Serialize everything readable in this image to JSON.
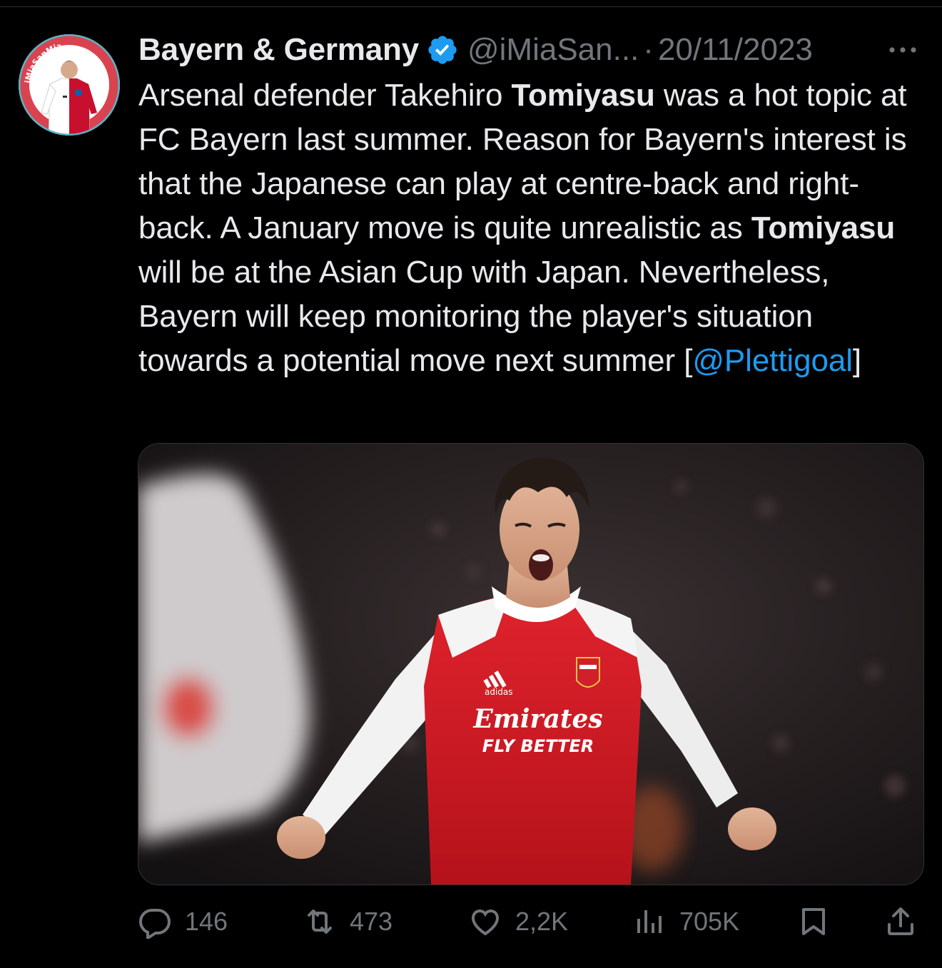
{
  "author": {
    "display_name": "Bayern & Germany",
    "handle": "@iMiaSan...",
    "separator": "·",
    "date": "20/11/2023",
    "verified": true,
    "badge_color": "#1d9bf0",
    "avatar_text": "iMiaSanMia"
  },
  "tweet": {
    "segments": [
      {
        "text": "Arsenal defender Takehiro ",
        "style": "normal"
      },
      {
        "text": "Tomiyasu",
        "style": "bold"
      },
      {
        "text": " was a hot topic at FC Bayern last summer. Reason for Bayern's interest is that the Japanese can play at centre-back and right-back. A January move is quite unrealistic as ",
        "style": "normal"
      },
      {
        "text": "Tomiyasu",
        "style": "bold"
      },
      {
        "text": " will be at the Asian Cup with Japan. Nevertheless, Bayern will keep monitoring the player's situation towards a potential move next summer [",
        "style": "normal"
      },
      {
        "text": "@Plettigoal",
        "style": "mention"
      },
      {
        "text": "]",
        "style": "normal"
      }
    ]
  },
  "media": {
    "shirt_sponsor": "Emirates",
    "shirt_tagline": "FLY BETTER",
    "shirt_brand": "adidas"
  },
  "actions": {
    "replies": "146",
    "reposts": "473",
    "likes": "2,2K",
    "views": "705K"
  },
  "icons": {
    "more": "more-horizontal-icon",
    "reply": "reply-icon",
    "repost": "repost-icon",
    "like": "heart-icon",
    "views": "views-chart-icon",
    "bookmark": "bookmark-icon",
    "share": "share-icon"
  },
  "colors": {
    "background": "#000000",
    "text_primary": "#e7e9ea",
    "text_secondary": "#71767b",
    "link": "#1d9bf0",
    "divider": "#2f3336"
  }
}
